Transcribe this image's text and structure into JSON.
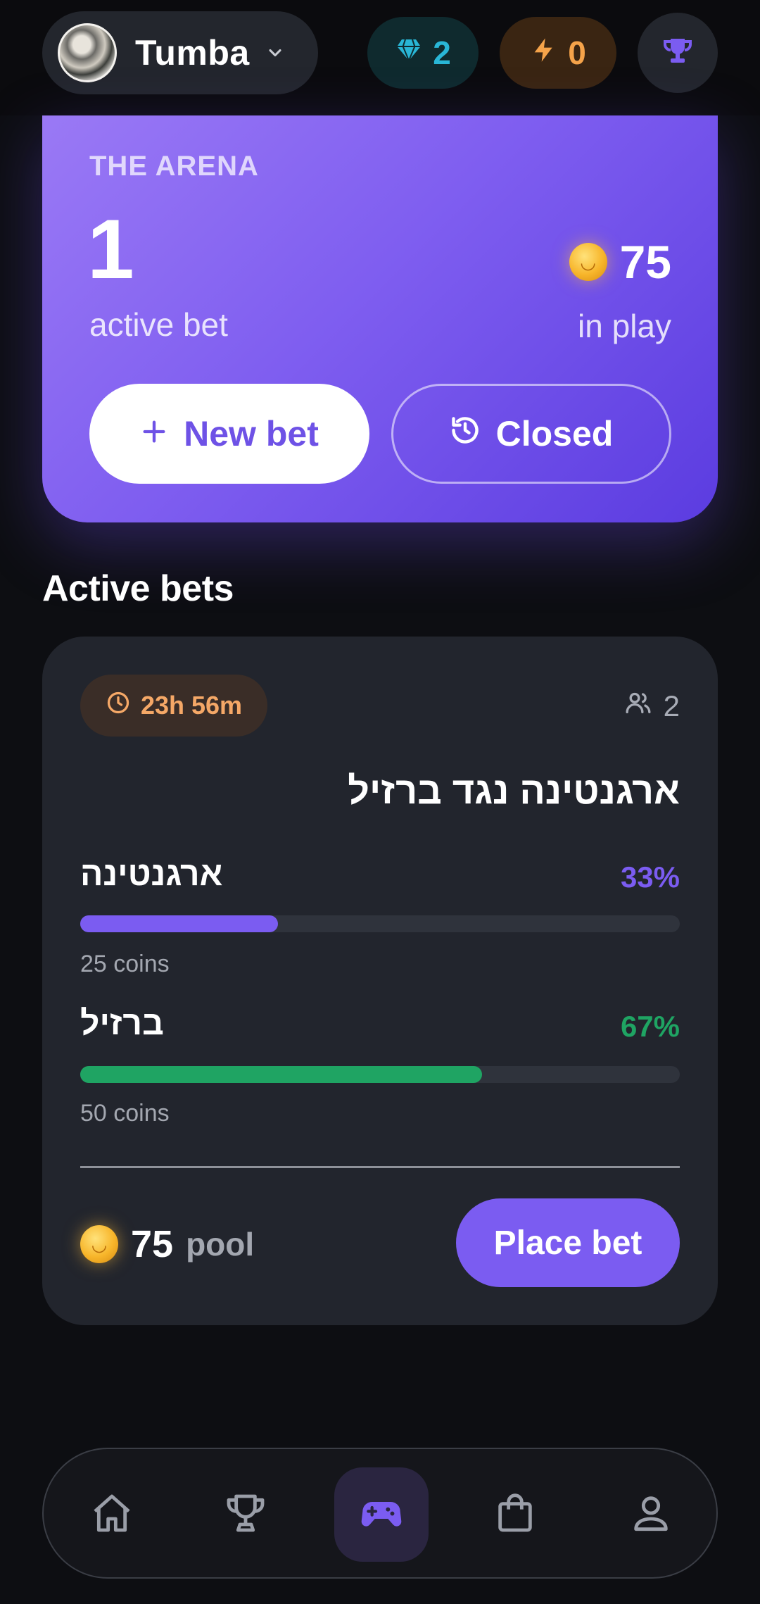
{
  "header": {
    "group_name": "Tumba",
    "gems": "2",
    "energy": "0"
  },
  "arena": {
    "title": "THE ARENA",
    "active_count": "1",
    "active_label": "active bet",
    "in_play_value": "75",
    "in_play_label": "in play",
    "new_bet_label": "New bet",
    "closed_label": "Closed"
  },
  "active_bets": {
    "section_title": "Active bets",
    "bets": [
      {
        "timer": "23h 56m",
        "participants": "2",
        "question": "ארגנטינה נגד ברזיל",
        "options": [
          {
            "name": "ארגנטינה",
            "percent": "33%",
            "share": 0.33,
            "coins": "25 coins",
            "color": "#7b5cf1"
          },
          {
            "name": "ברזיל",
            "percent": "67%",
            "share": 0.67,
            "coins": "50 coins",
            "color": "#1fa463"
          }
        ],
        "pool_value": "75",
        "pool_label": "pool",
        "place_bet_label": "Place bet"
      }
    ]
  },
  "colors": {
    "accent": "#7b5cf1",
    "green": "#1fa463",
    "gem": "#29b6d6",
    "energy": "#f5a34a",
    "timer": "#f5a867"
  },
  "nav": {
    "items": [
      "home-icon",
      "trophy-icon",
      "gamepad-icon",
      "shopping-bag-icon",
      "profile-icon"
    ],
    "active_index": 2
  }
}
